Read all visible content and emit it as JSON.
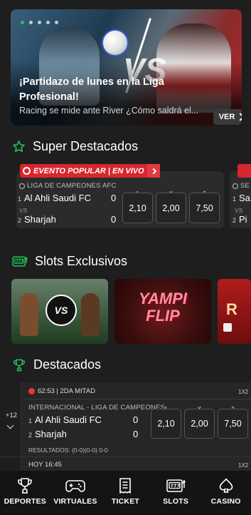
{
  "hero": {
    "title": "¡Partidazo de lunes en la Liga Profesional!",
    "subtitle": "Racing se mide ante River ¿Cómo saldrá el...",
    "cta": "VER",
    "vs_graphic": "VS",
    "carousel_dots": 5,
    "active_dot": 0
  },
  "super_destacados": {
    "title": "Super Destacados",
    "badge": "EVENTO POPULAR | EN VIVO",
    "event": {
      "league": "LIGA DE CAMPEONES AFC",
      "team1_num": "1",
      "team1": "Al Ahli Saudi FC",
      "team1_score": "0",
      "vs": "VS",
      "team2_num": "2",
      "team2": "Sharjah",
      "team2_score": "0",
      "odds_labels": [
        "1",
        "X",
        "2"
      ],
      "odds": [
        "2,10",
        "2,00",
        "7,50"
      ]
    },
    "next_event_partial": {
      "league": "SE",
      "team1_num": "1",
      "team1": "Sa",
      "vs": "VS",
      "team2_num": "2",
      "team2": "Pi"
    }
  },
  "slots": {
    "title": "Slots Exclusivos",
    "tiles": [
      {
        "name": "VS horses",
        "label": "VS"
      },
      {
        "name": "Yampi Flip",
        "label": "YAMPI FLIP"
      },
      {
        "name": "R slot",
        "label": "R"
      }
    ]
  },
  "destacados": {
    "title": "Destacados",
    "more_markets": "+12",
    "event": {
      "time_status": "62:53 | 2DA MITAD",
      "market": "1X2",
      "league": "INTERNACIONAL - LIGA DE CAMPEONES ...",
      "team1_num": "1",
      "team1": "Al Ahli Saudi FC",
      "team1_score": "0",
      "team2_num": "2",
      "team2": "Sharjah",
      "team2_score": "0",
      "odds_labels": [
        "1",
        "X",
        "2"
      ],
      "odds": [
        "2,10",
        "2,00",
        "7,50"
      ],
      "results": "RESULTADOS: (0-0)(0-0) 0-0"
    },
    "next": {
      "time": "HOY 16:45",
      "market": "1X2"
    }
  },
  "bottom_nav": [
    {
      "label": "DEPORTES",
      "icon": "trophy-icon"
    },
    {
      "label": "VIRTUALES",
      "icon": "gamepad-icon"
    },
    {
      "label": "TICKET",
      "icon": "receipt-icon"
    },
    {
      "label": "SLOTS",
      "icon": "slot-machine-icon"
    },
    {
      "label": "CASINO",
      "icon": "spade-icon"
    }
  ],
  "colors": {
    "background": "#1e1e1e",
    "card": "#2b2b2b",
    "accent_green": "#22c55e",
    "live_red": "#d7262d",
    "nav": "#141414"
  }
}
